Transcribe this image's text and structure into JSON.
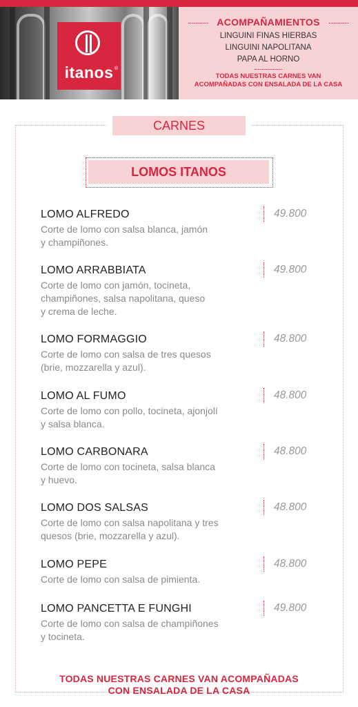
{
  "brand": {
    "name": "itanos"
  },
  "accompaniments": {
    "title": "ACOMPAÑAMIENTOS",
    "items": [
      "LINGUINI FINAS HIERBAS",
      "LINGUINI NAPOLITANA",
      "PAPA AL HORNO"
    ],
    "note_line1": "TODAS NUESTRAS CARNES VAN",
    "note_line2": "ACOMPAÑADAS CON ENSALADA DE LA CASA"
  },
  "section": {
    "title": "CARNES",
    "subtitle": "LOMOS ITANOS"
  },
  "items": [
    {
      "name": "LOMO ALFREDO",
      "desc": [
        "Corte de lomo con salsa blanca, jamón",
        "y champiñones."
      ],
      "price": "49.800"
    },
    {
      "name": "LOMO ARRABBIATA",
      "desc": [
        "Corte de lomo con jamón, tocineta,",
        "champiñones, salsa napolitana, queso",
        "y crema de leche."
      ],
      "price": "49.800"
    },
    {
      "name": "LOMO FORMAGGIO",
      "desc": [
        "Corte de lomo con salsa de tres quesos",
        "(brie, mozzarella y azul)."
      ],
      "price": "48.800"
    },
    {
      "name": "LOMO AL FUMO",
      "desc": [
        "Corte de lomo con pollo, tocineta, ajonjolí",
        "y salsa blanca."
      ],
      "price": "48.800"
    },
    {
      "name": "LOMO CARBONARA",
      "desc": [
        "Corte de lomo con tocineta, salsa blanca",
        "y huevo."
      ],
      "price": "48.800"
    },
    {
      "name": "LOMO DOS SALSAS",
      "desc": [
        "Corte de lomo con salsa napolitana y tres",
        "quesos (brie, mozzarella y azul)."
      ],
      "price": "48.800"
    },
    {
      "name": "LOMO PEPE",
      "desc": [
        "Corte de lomo con salsa de pimienta."
      ],
      "price": "48.800"
    },
    {
      "name": "LOMO PANCETTA E FUNGHI",
      "desc": [
        "Corte de lomo con salsa de champiñones",
        "y tocineta."
      ],
      "price": "49.800"
    }
  ],
  "footer": {
    "line1": "TODAS NUESTRAS CARNES VAN ACOMPAÑADAS",
    "line2": "CON ENSALADA DE LA CASA"
  }
}
